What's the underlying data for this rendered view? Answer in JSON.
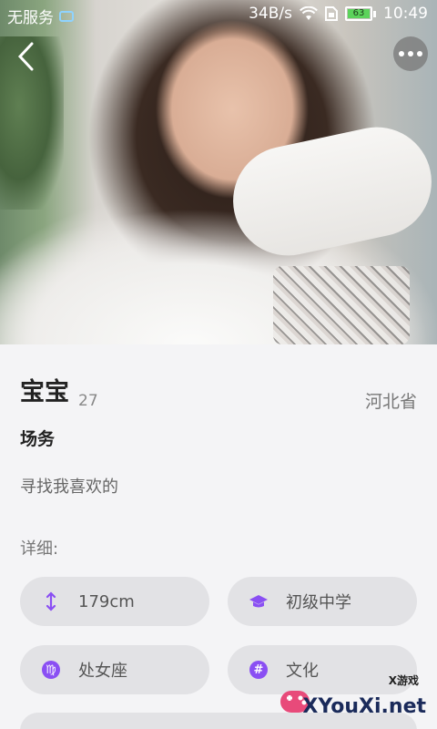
{
  "status_bar": {
    "carrier": "无服务",
    "speed": "34B/s",
    "battery": "63",
    "time": "10:49"
  },
  "profile": {
    "name": "宝宝",
    "age": "27",
    "location": "河北省",
    "job": "场务",
    "bio": "寻找我喜欢的",
    "details_label": "详细:"
  },
  "details": [
    {
      "icon": "height-icon",
      "text": "179cm"
    },
    {
      "icon": "graduation-cap-icon",
      "text": "初级中学"
    },
    {
      "icon": "zodiac-virgo-icon",
      "text": "处女座"
    },
    {
      "icon": "hashtag-icon",
      "text": "文化"
    }
  ],
  "watermark": {
    "small": "X游戏",
    "big": "XYouXi.net"
  },
  "colors": {
    "accent": "#8a4ff3",
    "chip_bg": "#e2e2e5",
    "page_bg": "#f4f4f6"
  }
}
